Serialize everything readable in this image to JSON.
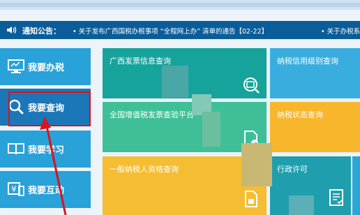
{
  "notice": {
    "label": "通知公告：",
    "messages": [
      "• 关于发布广西国税办税事项  “全程网上办” 清单的通告【02-22】",
      "• 关于办税系"
    ]
  },
  "sidebar": {
    "items": [
      {
        "label": "我要办税",
        "icon": "monitor-icon"
      },
      {
        "label": "我要查询",
        "icon": "search-icon"
      },
      {
        "label": "我要学习",
        "icon": "book-icon"
      },
      {
        "label": "我要互动",
        "icon": "interact-icon"
      }
    ]
  },
  "tiles": {
    "invoice_query": "广西发票信息查询",
    "credit_query": "纳税信用级别查询",
    "vat_platform": "全国增值税发票查验平台",
    "taxpayer_status": "纳税状态查询",
    "general_taxpayer": "一般纳税人资格查询",
    "admin_license": "行政许可"
  },
  "colors": {
    "notice_bg": "#0a5d99",
    "sidebar": "#29a1d9",
    "sidebar_active": "#1b77b8",
    "highlight": "#d9141c",
    "teal": "#16a39c",
    "sky": "#39aede",
    "green": "#3fbf97",
    "gold": "#f7b62c"
  }
}
